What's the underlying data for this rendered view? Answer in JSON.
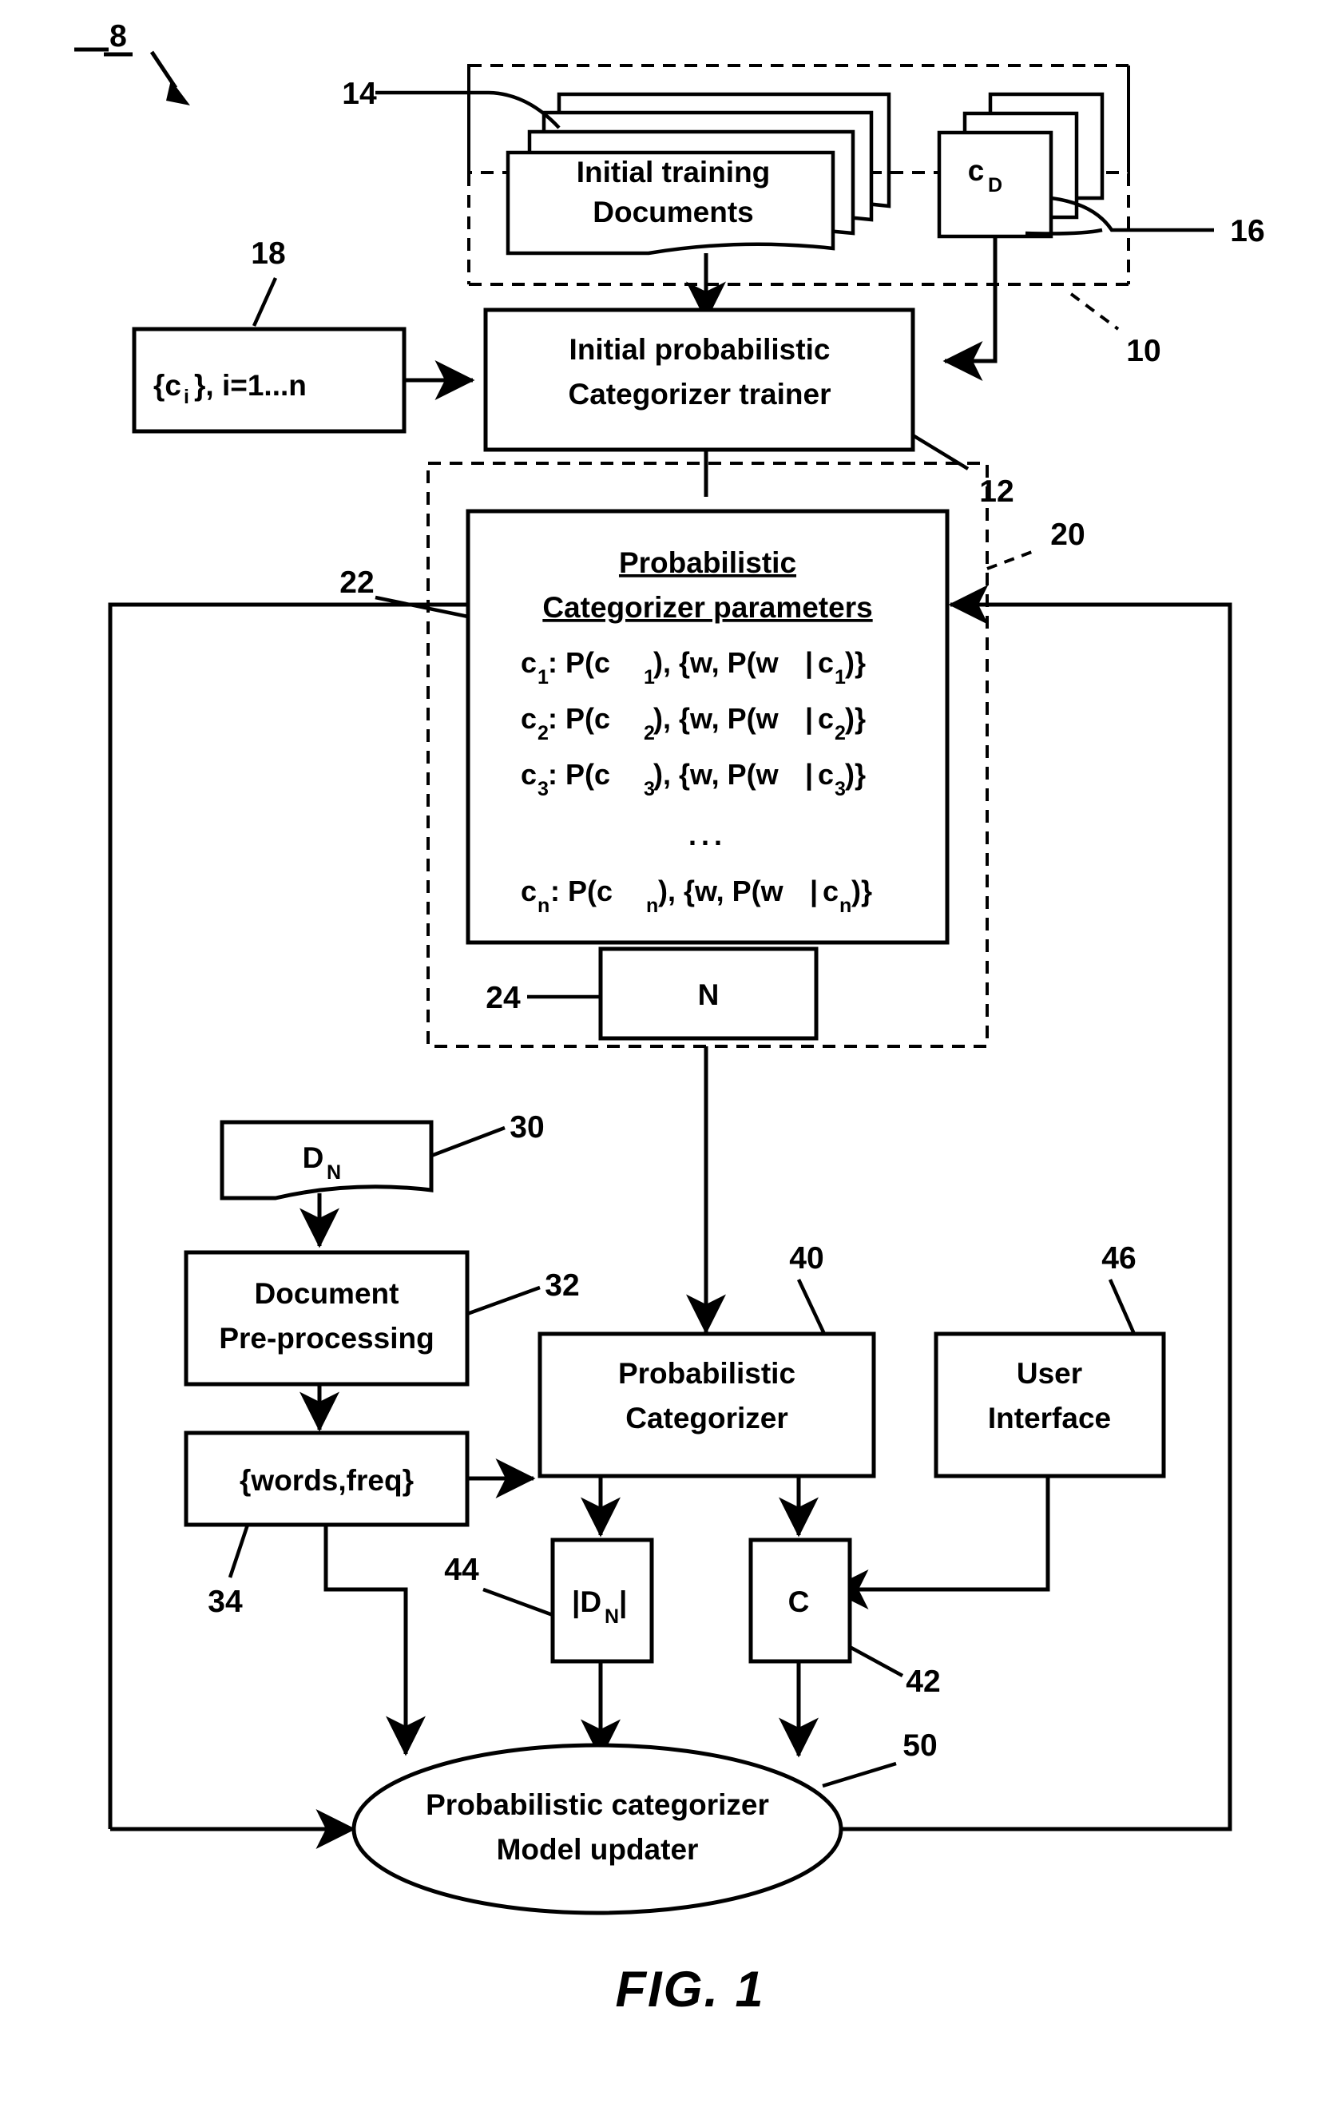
{
  "figure": {
    "caption": "FIG. 1",
    "system_ref": "8"
  },
  "refs": {
    "system": "8",
    "training_docs": "14",
    "training_categories": "16",
    "training_data_group": "10",
    "category_set": "18",
    "initial_trainer": "12",
    "model_group": "20",
    "parameters_box": "22",
    "count_n": "24",
    "new_document": "30",
    "preprocessing": "32",
    "words_freq": "34",
    "categorizer": "40",
    "category_output": "42",
    "doc_length": "44",
    "user_interface": "46",
    "model_updater": "50"
  },
  "nodes": {
    "training_documents": {
      "line1": "Initial training",
      "line2": "Documents"
    },
    "training_categories": {
      "label": "c",
      "subscript": "D"
    },
    "category_set": {
      "text": "{cᵢ}, i=1...n",
      "base": "{c",
      "sub": "i",
      "tail": "}, i=1...n"
    },
    "initial_trainer": {
      "line1": "Initial probabilistic",
      "line2": "Categorizer trainer"
    },
    "parameters": {
      "title_line1": "Probabilistic",
      "title_line2": "Categorizer parameters",
      "rows": [
        {
          "cat": "c",
          "cat_sub": "1",
          "body": ":  P(c₁), {w, P(w|c₁)}"
        },
        {
          "cat": "c",
          "cat_sub": "2",
          "body": ":  P(c₂), {w, P(w|c₂)}"
        },
        {
          "cat": "c",
          "cat_sub": "3",
          "body": ":  P(c₃), {w, P(w|c₃)}"
        },
        {
          "cat": "",
          "cat_sub": "",
          "body": "..."
        },
        {
          "cat": "c",
          "cat_sub": "n",
          "body": ":  P(cₙ), {w, P(w|cₙ)}"
        }
      ],
      "row1_pre": "c",
      "row1_sub": "1",
      "row1_post": ":  P(c",
      "ellipsis": "..."
    },
    "count_box": {
      "label": "N"
    },
    "new_document": {
      "label": "D",
      "subscript": "N"
    },
    "preprocessing": {
      "line1": "Document",
      "line2": "Pre-processing"
    },
    "words_freq": {
      "label": "{words,freq}"
    },
    "categorizer": {
      "line1": "Probabilistic",
      "line2": "Categorizer"
    },
    "user_interface": {
      "line1": "User",
      "line2": "Interface"
    },
    "doc_length": {
      "label": "|D",
      "subscript": "N",
      "tail": "|"
    },
    "category_output": {
      "label": "C"
    },
    "model_updater": {
      "line1": "Probabilistic categorizer",
      "line2": "Model updater"
    }
  },
  "parameter_rows": [
    {
      "id": "p1",
      "cat": "c",
      "sub": "1",
      "t1": ":  P(c",
      "s1": "1",
      "t2": "), {w, P(w",
      "bar": "|",
      "t3": "c",
      "s2": "1",
      "t4": ")}"
    },
    {
      "id": "p2",
      "cat": "c",
      "sub": "2",
      "t1": ":  P(c",
      "s1": "2",
      "t2": "), {w, P(w",
      "bar": "|",
      "t3": "c",
      "s2": "2",
      "t4": ")}"
    },
    {
      "id": "p3",
      "cat": "c",
      "sub": "3",
      "t1": ":  P(c",
      "s1": "3",
      "t2": "), {w, P(w",
      "bar": "|",
      "t3": "c",
      "s2": "3",
      "t4": ")}"
    },
    {
      "id": "pn",
      "cat": "c",
      "sub": "n",
      "t1": ":  P(c",
      "s1": "n",
      "t2": "), {w, P(w",
      "bar": "|",
      "t3": "c",
      "s2": "n",
      "t4": ")}"
    }
  ],
  "colors": {
    "ink": "#000000",
    "paper": "#ffffff"
  }
}
